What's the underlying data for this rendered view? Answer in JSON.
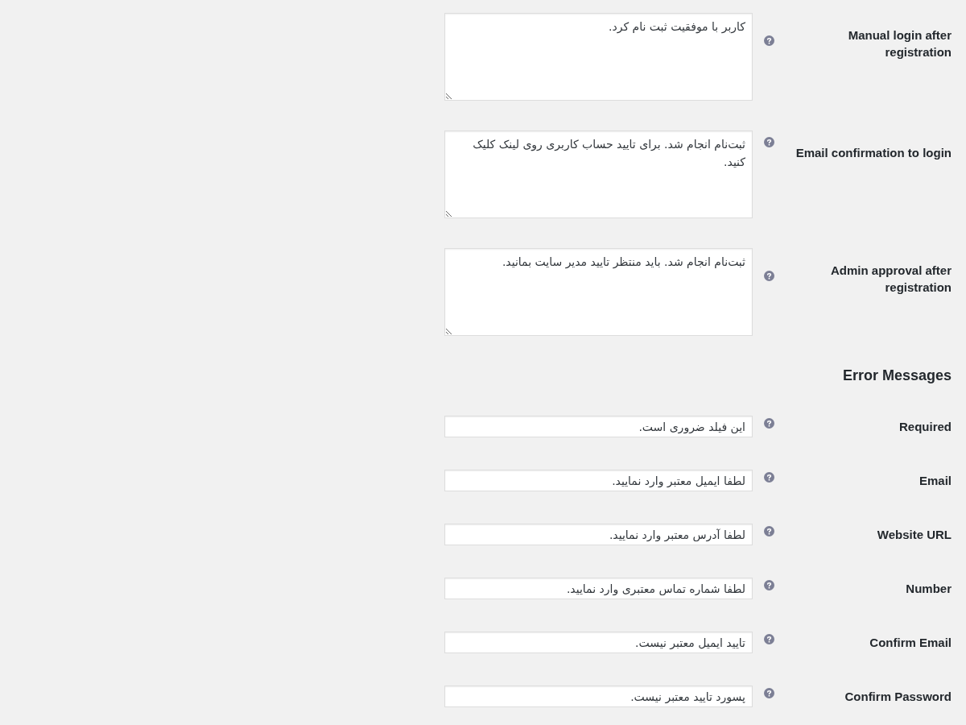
{
  "rows": [
    {
      "kind": "textarea",
      "label": "Manual login after registration",
      "value": "کاربر با موفقیت ثبت نام کرد."
    },
    {
      "kind": "textarea",
      "label": "Email confirmation to login",
      "value": "ثبت‌نام انجام شد. برای تایید حساب کاربری روی لینک کلیک کنید."
    },
    {
      "kind": "textarea",
      "label": "Admin approval after registration",
      "value": "ثبت‌نام انجام شد. باید منتظر تایید مدیر سایت بمانید."
    },
    {
      "kind": "heading",
      "label": "Error Messages"
    },
    {
      "kind": "text",
      "label": "Required",
      "value": "این فیلد ضروری است."
    },
    {
      "kind": "text",
      "label": "Email",
      "value": "لطفا ایمیل معتبر وارد نمایید."
    },
    {
      "kind": "text",
      "label": "Website URL",
      "value": "لطفا آدرس معتبر وارد نمایید."
    },
    {
      "kind": "text",
      "label": "Number",
      "value": "لطفا شماره تماس معتبری وارد نمایید."
    },
    {
      "kind": "text",
      "label": "Confirm Email",
      "value": "تایید ایمیل معتبر نیست."
    },
    {
      "kind": "text",
      "label": "Confirm Password",
      "value": "پسورد تایید معتبر نیست."
    }
  ]
}
